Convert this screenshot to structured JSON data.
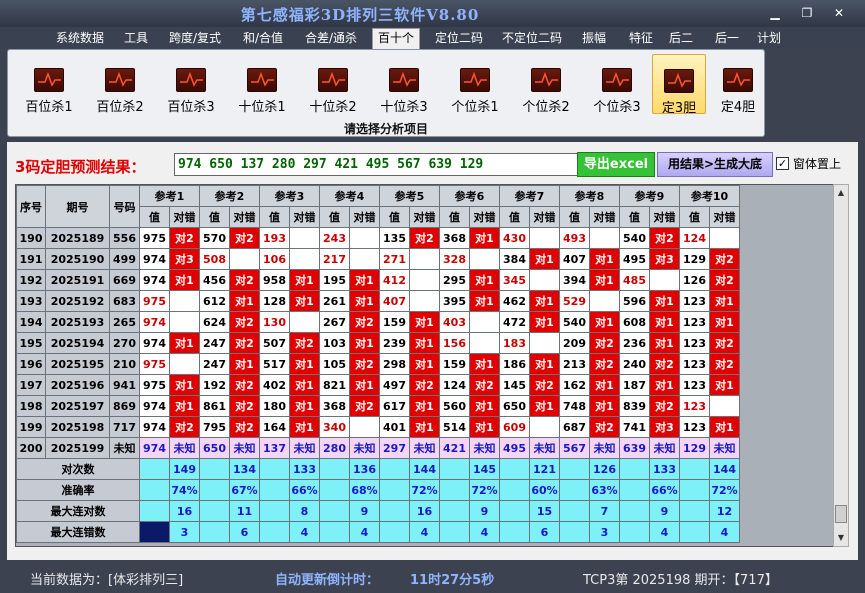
{
  "app": {
    "title": "第七感福彩3D排列三软件V8.80"
  },
  "window": {
    "minimize": "▁",
    "restore": "❐",
    "close": "✕"
  },
  "menu": [
    "系统数据",
    "工具",
    "跨度/复式",
    "和/合值",
    "合差/通杀",
    "百十个",
    "定位二码",
    "不定位二码",
    "振幅",
    "特征",
    "后二",
    "后一",
    "计划"
  ],
  "menu_active_index": 5,
  "ribbon": {
    "items": [
      "百位杀1",
      "百位杀2",
      "百位杀3",
      "十位杀1",
      "十位杀2",
      "十位杀3",
      "个位杀1",
      "个位杀2",
      "个位杀3",
      "定3胆",
      "定4胆"
    ],
    "selected_index": 9,
    "caption": "请选择分析项目"
  },
  "result": {
    "label": "3码定胆预测结果：",
    "text": "974 650 137 280 297 421 495 567 639 129",
    "export_label": "导出excel",
    "generate_label": "用结果>生成大底",
    "checkbox_label": "窗体置上",
    "checkbox_checked": true
  },
  "grid": {
    "headers": {
      "seq": "序号",
      "issue": "期号",
      "code": "号码",
      "val": "值",
      "flag": "对错"
    },
    "refs": [
      "参考1",
      "参考2",
      "参考3",
      "参考4",
      "参考5",
      "参考6",
      "参考7",
      "参考8",
      "参考9",
      "参考10"
    ],
    "rows": [
      {
        "seq": "190",
        "issue": "2025189",
        "code": "556",
        "cells": [
          [
            "975",
            "",
            "对2"
          ],
          [
            "570",
            "",
            "对2"
          ],
          [
            "193",
            "r",
            ""
          ],
          [
            "243",
            "r",
            ""
          ],
          [
            "135",
            "",
            "对2"
          ],
          [
            "368",
            "",
            "对1"
          ],
          [
            "430",
            "r",
            ""
          ],
          [
            "493",
            "r",
            ""
          ],
          [
            "540",
            "",
            "对2"
          ],
          [
            "124",
            "r",
            ""
          ]
        ]
      },
      {
        "seq": "191",
        "issue": "2025190",
        "code": "499",
        "cells": [
          [
            "974",
            "",
            "对3"
          ],
          [
            "508",
            "r",
            ""
          ],
          [
            "106",
            "r",
            ""
          ],
          [
            "217",
            "r",
            ""
          ],
          [
            "271",
            "r",
            ""
          ],
          [
            "328",
            "r",
            ""
          ],
          [
            "384",
            "",
            "对1"
          ],
          [
            "407",
            "",
            "对1"
          ],
          [
            "495",
            "",
            "对3"
          ],
          [
            "129",
            "",
            "对2"
          ]
        ]
      },
      {
        "seq": "192",
        "issue": "2025191",
        "code": "669",
        "cells": [
          [
            "974",
            "",
            "对1"
          ],
          [
            "456",
            "",
            "对2"
          ],
          [
            "958",
            "",
            "对1"
          ],
          [
            "195",
            "",
            "对1"
          ],
          [
            "412",
            "r",
            ""
          ],
          [
            "295",
            "",
            "对1"
          ],
          [
            "345",
            "r",
            ""
          ],
          [
            "394",
            "",
            "对1"
          ],
          [
            "485",
            "r",
            ""
          ],
          [
            "126",
            "",
            "对2"
          ]
        ]
      },
      {
        "seq": "193",
        "issue": "2025192",
        "code": "683",
        "cells": [
          [
            "975",
            "r",
            ""
          ],
          [
            "612",
            "",
            "对1"
          ],
          [
            "128",
            "",
            "对1"
          ],
          [
            "261",
            "",
            "对1"
          ],
          [
            "407",
            "r",
            ""
          ],
          [
            "395",
            "",
            "对1"
          ],
          [
            "462",
            "",
            "对1"
          ],
          [
            "529",
            "r",
            ""
          ],
          [
            "596",
            "",
            "对1"
          ],
          [
            "123",
            "",
            "对1"
          ]
        ]
      },
      {
        "seq": "194",
        "issue": "2025193",
        "code": "265",
        "cells": [
          [
            "974",
            "r",
            ""
          ],
          [
            "624",
            "",
            "对2"
          ],
          [
            "130",
            "r",
            ""
          ],
          [
            "267",
            "",
            "对2"
          ],
          [
            "159",
            "",
            "对1"
          ],
          [
            "403",
            "r",
            ""
          ],
          [
            "472",
            "",
            "对1"
          ],
          [
            "540",
            "",
            "对1"
          ],
          [
            "608",
            "",
            "对1"
          ],
          [
            "123",
            "",
            "对1"
          ]
        ]
      },
      {
        "seq": "195",
        "issue": "2025194",
        "code": "270",
        "cells": [
          [
            "974",
            "",
            "对1"
          ],
          [
            "247",
            "",
            "对2"
          ],
          [
            "507",
            "",
            "对2"
          ],
          [
            "103",
            "",
            "对1"
          ],
          [
            "239",
            "",
            "对1"
          ],
          [
            "156",
            "r",
            ""
          ],
          [
            "183",
            "r",
            ""
          ],
          [
            "209",
            "",
            "对2"
          ],
          [
            "236",
            "",
            "对1"
          ],
          [
            "123",
            "",
            "对2"
          ]
        ]
      },
      {
        "seq": "196",
        "issue": "2025195",
        "code": "210",
        "cells": [
          [
            "975",
            "r",
            ""
          ],
          [
            "247",
            "",
            "对1"
          ],
          [
            "517",
            "",
            "对1"
          ],
          [
            "105",
            "",
            "对2"
          ],
          [
            "298",
            "",
            "对1"
          ],
          [
            "159",
            "",
            "对1"
          ],
          [
            "186",
            "",
            "对1"
          ],
          [
            "213",
            "",
            "对2"
          ],
          [
            "240",
            "",
            "对2"
          ],
          [
            "123",
            "",
            "对2"
          ]
        ]
      },
      {
        "seq": "197",
        "issue": "2025196",
        "code": "941",
        "cells": [
          [
            "975",
            "",
            "对1"
          ],
          [
            "192",
            "",
            "对2"
          ],
          [
            "402",
            "",
            "对1"
          ],
          [
            "821",
            "",
            "对1"
          ],
          [
            "497",
            "",
            "对2"
          ],
          [
            "124",
            "",
            "对2"
          ],
          [
            "145",
            "",
            "对2"
          ],
          [
            "162",
            "",
            "对1"
          ],
          [
            "187",
            "",
            "对1"
          ],
          [
            "123",
            "",
            "对1"
          ]
        ]
      },
      {
        "seq": "198",
        "issue": "2025197",
        "code": "869",
        "cells": [
          [
            "974",
            "",
            "对1"
          ],
          [
            "861",
            "",
            "对2"
          ],
          [
            "180",
            "",
            "对1"
          ],
          [
            "368",
            "",
            "对2"
          ],
          [
            "617",
            "",
            "对1"
          ],
          [
            "560",
            "",
            "对1"
          ],
          [
            "650",
            "",
            "对1"
          ],
          [
            "748",
            "",
            "对1"
          ],
          [
            "839",
            "",
            "对2"
          ],
          [
            "123",
            "r",
            ""
          ]
        ]
      },
      {
        "seq": "199",
        "issue": "2025198",
        "code": "717",
        "cells": [
          [
            "974",
            "",
            "对2"
          ],
          [
            "795",
            "",
            "对2"
          ],
          [
            "164",
            "",
            "对1"
          ],
          [
            "340",
            "r",
            ""
          ],
          [
            "401",
            "",
            "对1"
          ],
          [
            "514",
            "",
            "对1"
          ],
          [
            "609",
            "r",
            ""
          ],
          [
            "687",
            "",
            "对2"
          ],
          [
            "741",
            "",
            "对3"
          ],
          [
            "123",
            "",
            "对1"
          ]
        ]
      }
    ],
    "pending": {
      "seq": "200",
      "issue": "2025199",
      "code": "未知",
      "cells": [
        [
          "974",
          "未知"
        ],
        [
          "650",
          "未知"
        ],
        [
          "137",
          "未知"
        ],
        [
          "280",
          "未知"
        ],
        [
          "297",
          "未知"
        ],
        [
          "421",
          "未知"
        ],
        [
          "495",
          "未知"
        ],
        [
          "567",
          "未知"
        ],
        [
          "639",
          "未知"
        ],
        [
          "129",
          "未知"
        ]
      ]
    },
    "stats": [
      {
        "label": "对次数",
        "values": [
          "149",
          "134",
          "133",
          "136",
          "144",
          "145",
          "121",
          "126",
          "133",
          "144"
        ]
      },
      {
        "label": "准确率",
        "values": [
          "74%",
          "67%",
          "66%",
          "68%",
          "72%",
          "72%",
          "60%",
          "63%",
          "66%",
          "72%"
        ]
      },
      {
        "label": "最大连对数",
        "values": [
          "16",
          "11",
          "8",
          "9",
          "16",
          "9",
          "15",
          "7",
          "9",
          "12"
        ]
      },
      {
        "label": "最大连错数",
        "values": [
          "3",
          "6",
          "4",
          "4",
          "4",
          "4",
          "6",
          "3",
          "4",
          "4"
        ]
      }
    ]
  },
  "status": {
    "current": "当前数据为：[体彩排列三]",
    "countdown_label": "自动更新倒计时：",
    "countdown": "11时27分5秒",
    "draw": "TCP3第 2025198 期开：【717】"
  },
  "colors": {
    "hit": "#e00000",
    "pending_bg": "#f5d5f5",
    "stats_bg": "#7ef0f8",
    "text_blue": "#1818c8",
    "title": "#8fb4ff"
  }
}
